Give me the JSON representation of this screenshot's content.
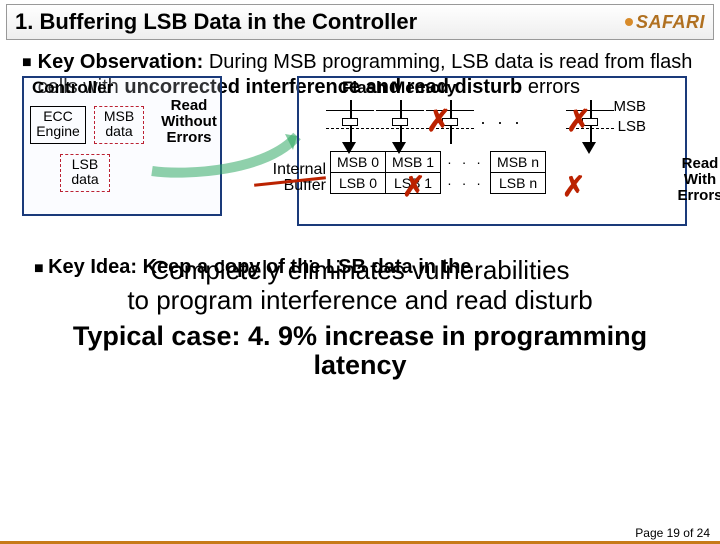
{
  "brand": "SAFARI",
  "title": "1. Buffering LSB Data in the Controller",
  "observation": {
    "lead": "Key Observation:",
    "rest_1": " During MSB programming, LSB data is read from flash cells with ",
    "bold_2": "uncorrected interference and read disturb",
    "rest_2": " errors"
  },
  "controller": {
    "label": "Controller",
    "ecc": "ECC Engine",
    "msb": "MSB data",
    "lsb": "LSB data",
    "read_without": "Read Without Errors"
  },
  "flash": {
    "label": "Flash Memory",
    "msb": "MSB",
    "lsb": "LSB",
    "buffer_label": "Internal Buffer",
    "read_with": "Read With Errors",
    "cells_msb": [
      "MSB 0",
      "MSB 1",
      "· · ·",
      "MSB n"
    ],
    "cells_lsb": [
      "LSB 0",
      "LSB 1",
      "· · ·",
      "LSB n"
    ]
  },
  "key_idea_hidden": "Key Idea: Keep a copy of the LSB data in the",
  "overlay_l1": "Completely eliminates vulnerabilities",
  "overlay_l2": "to program interference and read disturb",
  "typical_l1": "Typical case: 4. 9% increase in programming",
  "typical_l2": "latency",
  "footer": "Page 19 of 24"
}
